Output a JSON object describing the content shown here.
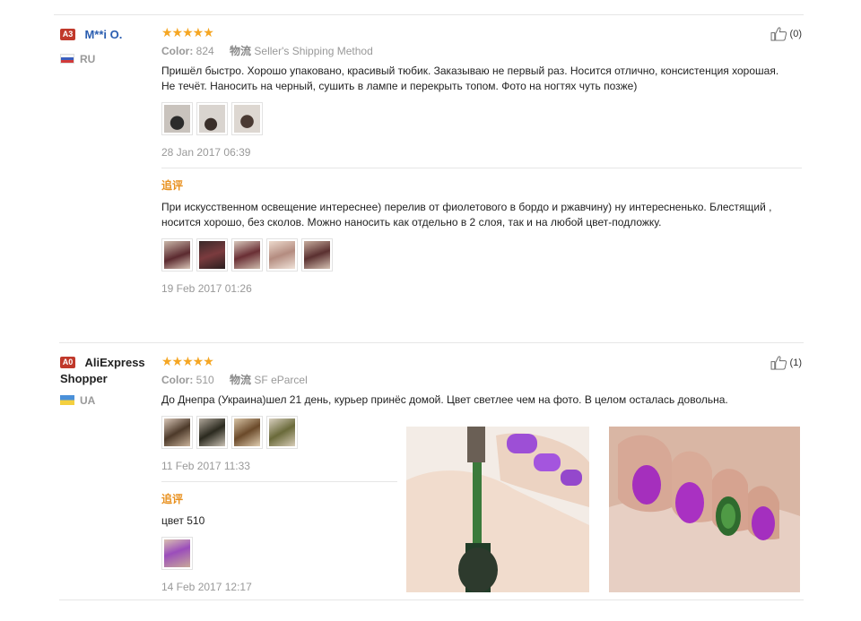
{
  "reviews": [
    {
      "badge": "A3",
      "username": "M**i O.",
      "country": "RU",
      "stars": "★★★★★",
      "color_label": "Color:",
      "color_value": "824",
      "shipping_label": "物流",
      "shipping_value": "Seller's Shipping Method",
      "text": "Пришёл быстро. Хорошо упаковано, красивый тюбик. Заказываю не первый раз. Носится отлично, консистенция хорошая. Не течёт. Наносить на черный, сушить в лампе и перекрыть топом. Фото на ногтях чуть позже)",
      "date": "28 Jan 2017 06:39",
      "likes": "(0)",
      "followup": {
        "label": "追评",
        "text": "При искусственном освещение интереснее) перелив от фиолетового в бордо и ржавчину) ну интересненько. Блестящий , носится хорошо, без сколов. Можно наносить как отдельно в 2 слоя, так и на любой цвет-подложку.",
        "date": "19 Feb 2017 01:26"
      }
    },
    {
      "badge": "A0",
      "username": "AliExpress Shopper",
      "country": "UA",
      "stars": "★★★★★",
      "color_label": "Color:",
      "color_value": "510",
      "shipping_label": "物流",
      "shipping_value": "SF eParcel",
      "text": "До Днепра (Украина)шел 21 день, курьер принёс домой. Цвет светлее чем на фото. В целом осталась довольна.",
      "date": "11 Feb 2017 11:33",
      "likes": "(1)",
      "followup": {
        "label": "追评",
        "text": "цвет 510",
        "date": "14 Feb 2017 12:17"
      }
    }
  ],
  "colors": {
    "star": "#f5a623",
    "followup_label": "#e8901e",
    "username": "#2a5db0"
  }
}
